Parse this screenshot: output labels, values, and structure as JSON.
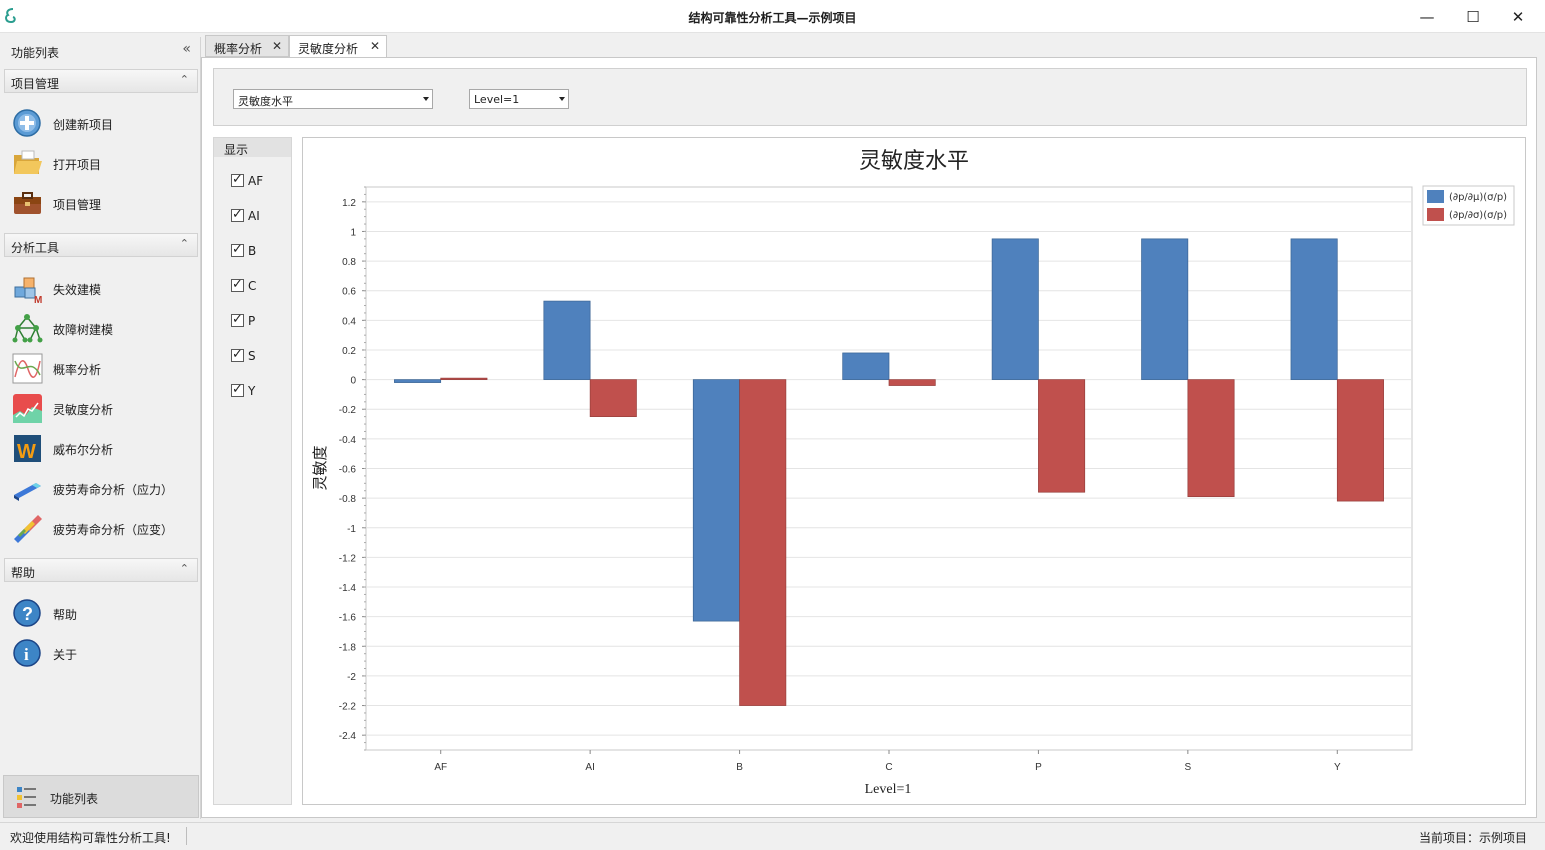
{
  "window": {
    "title": "结构可靠性分析工具—示例项目",
    "minimize_glyph": "—",
    "maximize_glyph": "☐",
    "close_glyph": "✕"
  },
  "sidebar": {
    "header": "功能列表",
    "collapse_glyph": "«",
    "groups": [
      {
        "label": "项目管理",
        "items": [
          {
            "label": "创建新项目",
            "icon": "add-circle-icon"
          },
          {
            "label": "打开项目",
            "icon": "folder-open-icon"
          },
          {
            "label": "项目管理",
            "icon": "briefcase-icon"
          }
        ]
      },
      {
        "label": "分析工具",
        "items": [
          {
            "label": "失效建模",
            "icon": "cubes-model-icon"
          },
          {
            "label": "故障树建模",
            "icon": "fault-tree-icon"
          },
          {
            "label": "概率分析",
            "icon": "probability-chart-icon"
          },
          {
            "label": "灵敏度分析",
            "icon": "sensitivity-chart-icon"
          },
          {
            "label": "威布尔分析",
            "icon": "weibull-icon"
          },
          {
            "label": "疲劳寿命分析（应力）",
            "icon": "stress-fatigue-icon"
          },
          {
            "label": "疲劳寿命分析（应变）",
            "icon": "strain-fatigue-icon"
          }
        ]
      },
      {
        "label": "帮助",
        "items": [
          {
            "label": "帮助",
            "icon": "help-icon"
          },
          {
            "label": "关于",
            "icon": "info-icon"
          }
        ]
      }
    ],
    "bottom_label": "功能列表"
  },
  "tabs": [
    {
      "label": "概率分析",
      "close": "✕",
      "active": false
    },
    {
      "label": "灵敏度分析",
      "close": "✕",
      "active": true
    }
  ],
  "controls": {
    "mode_select": "灵敏度水平",
    "level_select": "Level=1"
  },
  "show_panel": {
    "title": "显示",
    "items": [
      "AF",
      "AI",
      "B",
      "C",
      "P",
      "S",
      "Y"
    ]
  },
  "colors": {
    "series1": "#4f81bd",
    "series2": "#c0504d"
  },
  "chart_data": {
    "type": "bar",
    "title": "灵敏度水平",
    "xlabel": "Level=1",
    "ylabel": "灵敏度",
    "categories": [
      "AF",
      "AI",
      "B",
      "C",
      "P",
      "S",
      "Y"
    ],
    "series": [
      {
        "name": "(∂p/∂μ)(σ/p)",
        "values": [
          -0.02,
          0.53,
          -1.63,
          0.18,
          0.95,
          0.95,
          0.95
        ]
      },
      {
        "name": "(∂p/∂σ)(σ/p)",
        "values": [
          0.01,
          -0.25,
          -2.2,
          -0.04,
          -0.76,
          -0.79,
          -0.82
        ]
      }
    ],
    "ylim": [
      -2.5,
      1.3
    ],
    "yticks": [
      1.2,
      1,
      0.8,
      0.6,
      0.4,
      0.2,
      0,
      -0.2,
      -0.4,
      -0.6,
      -0.8,
      -1,
      -1.2,
      -1.4,
      -1.6,
      -1.8,
      -2,
      -2.2,
      -2.4
    ],
    "grid": true,
    "legend": "top-right"
  },
  "status": {
    "left": "欢迎使用结构可靠性分析工具!",
    "right": "当前项目：示例项目"
  }
}
